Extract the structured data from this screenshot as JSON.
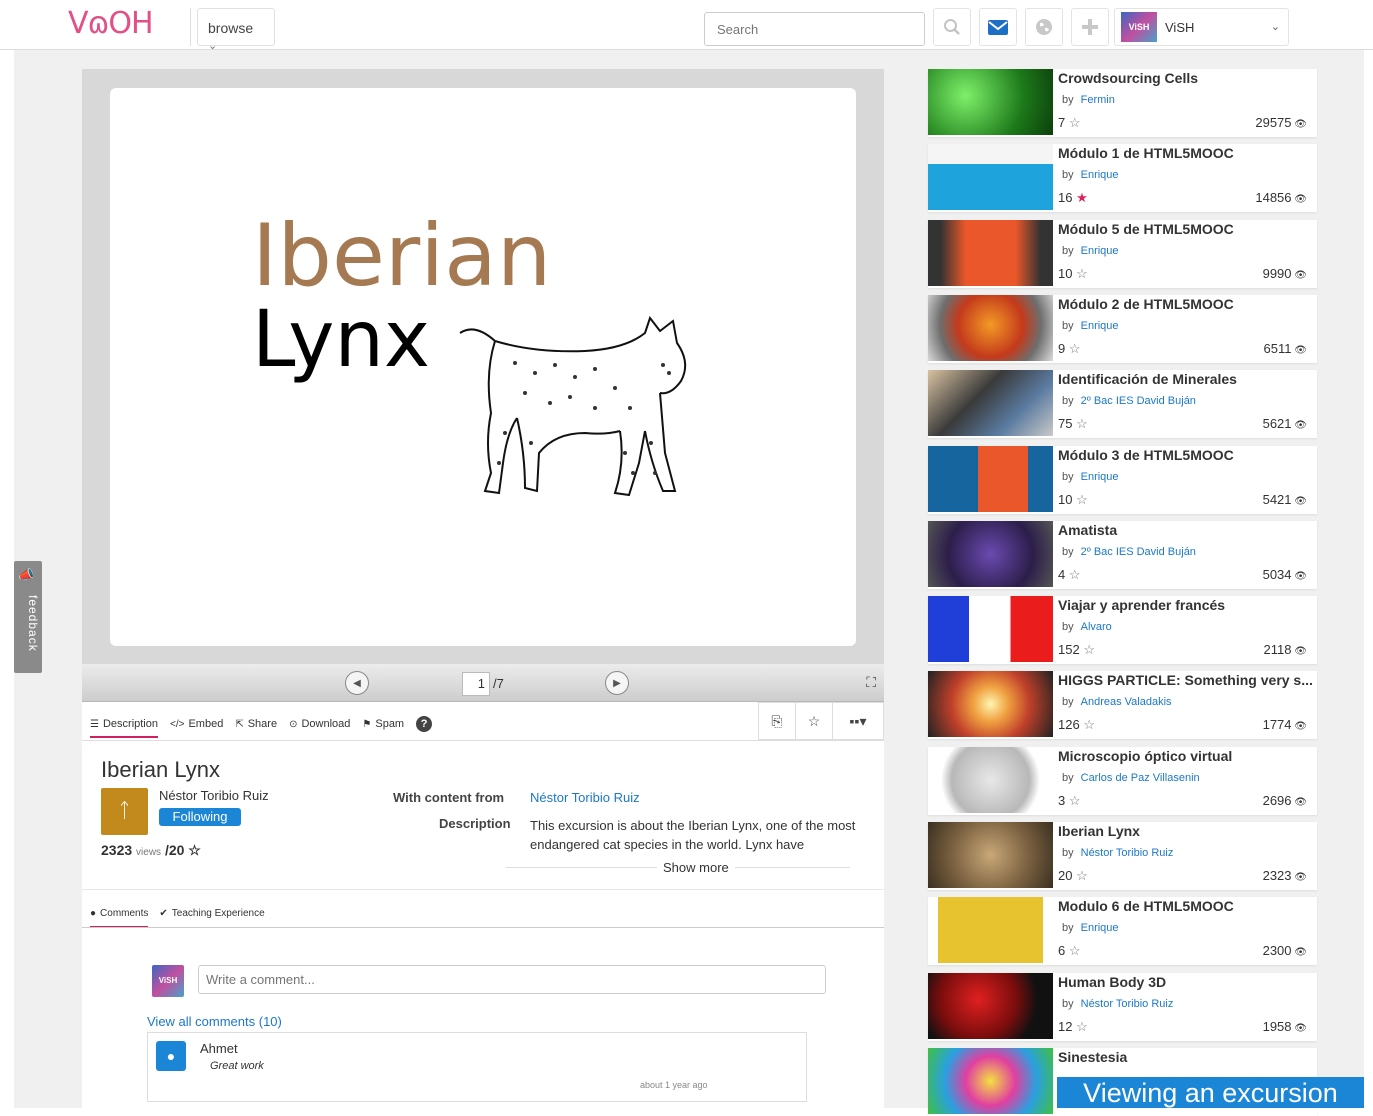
{
  "header": {
    "logo": "VɷOH",
    "browse_label": "browse",
    "browse_chevron": "⌄",
    "search_placeholder": "Search",
    "search_icon": "magnifier-icon",
    "mail_icon": "envelope-icon",
    "globe_icon": "globe-icon",
    "add_icon": "plus-icon",
    "user_avatar_text": "ViSH",
    "user_name": "ViSH",
    "user_chevron": "⌄"
  },
  "viewer": {
    "slide_title_line1": "Iberian",
    "slide_title_line2": "Lynx",
    "current_page": "1",
    "total_pages": "/7"
  },
  "info": {
    "tabs": [
      {
        "icon": "☰",
        "label": "Description"
      },
      {
        "icon": "</>",
        "label": "Embed"
      },
      {
        "icon": "⇱",
        "label": "Share"
      },
      {
        "icon": "⊙",
        "label": "Download"
      },
      {
        "icon": "⚑",
        "label": "Spam"
      }
    ],
    "help_icon": "?",
    "title": "Iberian Lynx",
    "author": "Néstor Toribio Ruiz",
    "follow_label": "Following",
    "views_count": "2323",
    "views_label": "views",
    "favs": "/20 ☆",
    "with_content_label": "With content from",
    "with_content_value": "Néstor Toribio Ruiz",
    "description_label": "Description",
    "description_text": "This excursion is about the Iberian Lynx, one of the most endangered cat species in the world. Lynx have",
    "show_more": "Show more"
  },
  "comments": {
    "tabs": [
      {
        "icon": "●",
        "label": "Comments"
      },
      {
        "icon": "✔",
        "label": "Teaching Experience"
      }
    ],
    "avatar_text": "ViSH",
    "input_placeholder": "Write a comment...",
    "view_all": "View all comments (10)",
    "items": [
      {
        "author": "Ahmet",
        "text": "Great work",
        "time": "about 1 year ago"
      }
    ]
  },
  "feedback": {
    "label": "feedback"
  },
  "sidebar": {
    "by_label": "by",
    "items": [
      {
        "title": "Crowdsourcing Cells",
        "author": "Fermin",
        "favs": "7",
        "views": "29575",
        "fav_active": false,
        "thumb": "green-cells"
      },
      {
        "title": "Módulo 1 de HTML5MOOC",
        "author": "Enrique",
        "favs": "16",
        "views": "14856",
        "fav_active": true,
        "thumb": "html5-future-browser"
      },
      {
        "title": "Módulo 5 de HTML5MOOC",
        "author": "Enrique",
        "favs": "10",
        "views": "9990",
        "fav_active": false,
        "thumb": "html5-shield"
      },
      {
        "title": "Módulo 2 de HTML5MOOC",
        "author": "Enrique",
        "favs": "9",
        "views": "6511",
        "fav_active": false,
        "thumb": "firefox-phone"
      },
      {
        "title": "Identificación de Minerales",
        "author": "2º Bac IES David Buján",
        "favs": "75",
        "views": "5621",
        "fav_active": false,
        "thumb": "phone-hand"
      },
      {
        "title": "Módulo 3 de HTML5MOOC",
        "author": "Enrique",
        "favs": "10",
        "views": "5421",
        "fav_active": false,
        "thumb": "firefox-html5"
      },
      {
        "title": "Amatista",
        "author": "2º Bac IES David Buján",
        "favs": "4",
        "views": "5034",
        "fav_active": false,
        "thumb": "amethyst"
      },
      {
        "title": "Viajar y aprender francés",
        "author": "Alvaro",
        "favs": "152",
        "views": "2118",
        "fav_active": false,
        "thumb": "french-flag"
      },
      {
        "title": "HIGGS PARTICLE: Something very s...",
        "author": "Andreas Valadakis",
        "favs": "126",
        "views": "1774",
        "fav_active": false,
        "thumb": "particle-burst"
      },
      {
        "title": "Microscopio óptico virtual",
        "author": "Carlos de Paz Villasenin",
        "favs": "3",
        "views": "2696",
        "fav_active": false,
        "thumb": "keyboard-sphere"
      },
      {
        "title": "Iberian Lynx",
        "author": "Néstor Toribio Ruiz",
        "favs": "20",
        "views": "2323",
        "fav_active": false,
        "thumb": "lynx-photo"
      },
      {
        "title": "Modulo 6 de HTML5MOOC",
        "author": "Enrique",
        "favs": "6",
        "views": "2300",
        "fav_active": false,
        "thumb": "html5-yellow"
      },
      {
        "title": "Human Body 3D",
        "author": "Néstor Toribio Ruiz",
        "favs": "12",
        "views": "1958",
        "fav_active": false,
        "thumb": "body-red"
      },
      {
        "title": "Sinestesia",
        "author": "",
        "favs": "",
        "views": "",
        "fav_active": false,
        "thumb": "colorful-brain"
      }
    ]
  },
  "banner": "Viewing an excursion",
  "colors": {
    "accent": "#1c86d6",
    "brand": "#e34f86",
    "tab_underline": "#d0215f",
    "star_active": "#e31e5d"
  }
}
